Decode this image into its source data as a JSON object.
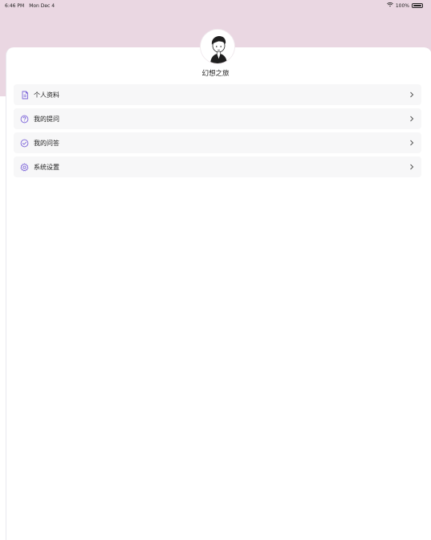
{
  "status_bar": {
    "time": "6:46 PM",
    "date": "Mon Dec 4",
    "battery": "100%"
  },
  "profile": {
    "username": "幻想之旅"
  },
  "menu": {
    "items": [
      {
        "label": "个人资料",
        "icon": "document-icon"
      },
      {
        "label": "我的提问",
        "icon": "question-circle-icon"
      },
      {
        "label": "我的问答",
        "icon": "check-circle-icon"
      },
      {
        "label": "系统设置",
        "icon": "gear-icon"
      }
    ]
  },
  "colors": {
    "header_band": "#ead7e2",
    "accent_icon": "#7b63d8",
    "row_bg": "#f7f7f8"
  }
}
